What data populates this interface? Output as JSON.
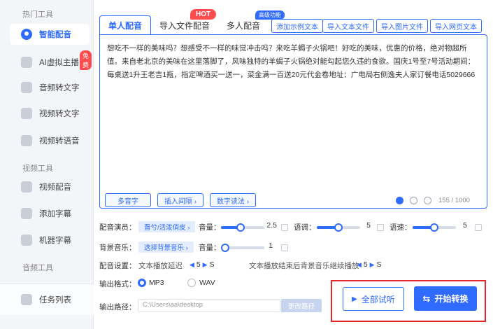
{
  "sidebar": {
    "section_hot": "热门工具",
    "section_video": "视频工具",
    "section_audio": "音频工具",
    "items": [
      {
        "label": "智能配音",
        "icon": "voice-icon"
      },
      {
        "label": "AI虚拟主播",
        "icon": "avatar-icon"
      },
      {
        "label": "音频转文字",
        "icon": "audio-text-icon"
      },
      {
        "label": "视频转文字",
        "icon": "video-text-icon"
      },
      {
        "label": "视频转语音",
        "icon": "video-voice-icon"
      },
      {
        "label": "视频配音",
        "icon": "video-dub-icon"
      },
      {
        "label": "添加字幕",
        "icon": "subtitle-icon"
      },
      {
        "label": "机器字幕",
        "icon": "machine-subtitle-icon"
      }
    ],
    "free_badge": "免费",
    "task_list": "任务列表"
  },
  "tabs": [
    {
      "label": "单人配音"
    },
    {
      "label": "导入文件配音"
    },
    {
      "label": "多人配音"
    }
  ],
  "hot_badge": "HOT",
  "pro_badge": "高级功能",
  "import_buttons": [
    "添加示例文本",
    "导入文本文件",
    "导入图片文件",
    "导入网页文本"
  ],
  "editor": {
    "text": "想吃不一样的美味吗？想感受不一样的味觉冲击吗？来吃羊蝎子火锅吧！好吃的美味，优惠的价格，绝对物超所值。来自老北京的美味在这里落脚了，风味独特的羊蝎子火锅绝对能勾起您久违的食欲。国庆1号至7号活动期间：每桌送1升王老吉1瓶，指定啤酒买一送一，菜金满一百送20元代金卷地址：广电局右侧逸夫人家订餐电话5029666",
    "btn_polyphone": "多音字",
    "btn_pause": "插入间隔 ›",
    "btn_number": "数字读法 ›",
    "counter": "155 / 1000"
  },
  "settings": {
    "voice_label": "配音演员：",
    "voice_value": "晋兮/活泼俏皮 ›",
    "volume_label": "音量：",
    "volume_value": "2.5",
    "volume_level": 0.45,
    "speed_label": "语调：",
    "speed_value": "5",
    "speed_level": 0.5,
    "rate_label": "语速：",
    "rate_value": "5",
    "rate_level": 0.5,
    "bgm_label": "背景音乐：",
    "bgm_value": "选择背景音乐 ›",
    "bgm_volume_label": "音量：",
    "bgm_volume_value": "1",
    "bgm_volume_level": 0.1,
    "config_label": "配音设置：",
    "delay_label": "文本播放延迟",
    "delay_value": "5",
    "delay_unit": "S",
    "bgm_continue_label": "文本播放结束后背景音乐继续播放",
    "bgm_continue_value": "5",
    "bgm_continue_unit": "S"
  },
  "output": {
    "format_label": "输出格式：",
    "format_mp3": "MP3",
    "format_wav": "WAV",
    "selected": "MP3",
    "path_label": "输出路径：",
    "path_value": "C:\\Users\\aa\\desktop",
    "change_path": "更改路径"
  },
  "actions": {
    "preview_all": "全部试听",
    "start_convert": "开始转换"
  },
  "colors": {
    "accent": "#2f6bff",
    "hot": "#ff4d4f",
    "highlight_box": "#e3282d"
  }
}
